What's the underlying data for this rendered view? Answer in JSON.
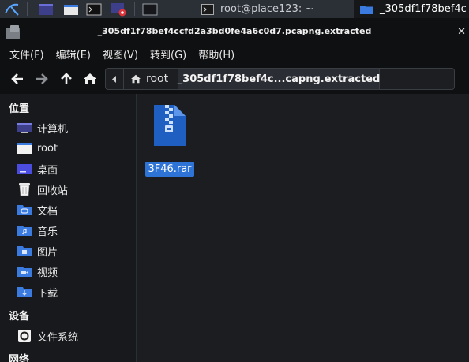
{
  "taskbar": {
    "windows": [
      {
        "title": "root@place123: ~",
        "icon": "terminal-icon"
      },
      {
        "title": "_305df1f78bef4c",
        "icon": "folder-icon",
        "active": true
      }
    ]
  },
  "window": {
    "title": "_305df1f78bef4ccfd2a3bd0fe4a6c0d7.pcapng.extracted",
    "close_glyph": "✕"
  },
  "menu": [
    "文件(F)",
    "编辑(E)",
    "视图(V)",
    "转到(G)",
    "帮助(H)"
  ],
  "breadcrumb": {
    "root_label": "root",
    "current_label": "_305df1f78bef4c...capng.extracted"
  },
  "sidebar": {
    "places_heading": "位置",
    "places": [
      {
        "label": "计算机",
        "icon": "computer-icon"
      },
      {
        "label": "root",
        "icon": "home-folder-icon"
      },
      {
        "label": "桌面",
        "icon": "desktop-icon"
      },
      {
        "label": "回收站",
        "icon": "trash-icon"
      },
      {
        "label": "文档",
        "icon": "documents-folder-icon"
      },
      {
        "label": "音乐",
        "icon": "music-folder-icon"
      },
      {
        "label": "图片",
        "icon": "pictures-folder-icon"
      },
      {
        "label": "视频",
        "icon": "videos-folder-icon"
      },
      {
        "label": "下载",
        "icon": "downloads-folder-icon"
      }
    ],
    "devices_heading": "设备",
    "devices": [
      {
        "label": "文件系统",
        "icon": "drive-icon"
      }
    ],
    "network_heading": "网络"
  },
  "files": [
    {
      "name": "3F46.rar",
      "icon": "archive-icon",
      "selected": true
    }
  ],
  "colors": {
    "accent": "#2e73d6",
    "folder": "#3b7be0",
    "archive": "#1f5fc2"
  }
}
